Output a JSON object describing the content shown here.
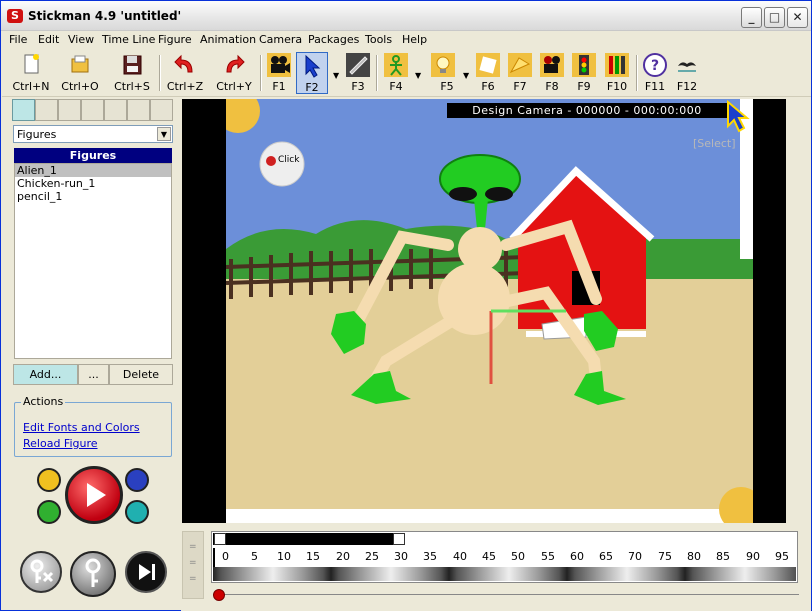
{
  "window": {
    "title": "Stickman 4.9  'untitled'",
    "logo_letter": "S"
  },
  "menu": [
    "File",
    "Edit",
    "View",
    "Time Line",
    "Figure",
    "Animation",
    "Camera",
    "Packages",
    "Tools",
    "Help"
  ],
  "toolbar": {
    "new_label": "Ctrl+N",
    "open_label": "Ctrl+O",
    "save_label": "Ctrl+S",
    "undo_label": "Ctrl+Z",
    "redo_label": "Ctrl+Y",
    "f1": "F1",
    "f2": "F2",
    "f3": "F3",
    "f4": "F4",
    "f5": "F5",
    "f6": "F6",
    "f7": "F7",
    "f8": "F8",
    "f9": "F9",
    "f10": "F10",
    "f11": "F11",
    "f12": "F12",
    "help_glyph": "?"
  },
  "left_panel": {
    "dropdown_value": "Figures",
    "list_header": "Figures",
    "items": [
      "Alien_1",
      "Chicken-run_1",
      "pencil_1"
    ],
    "selected_index": 0,
    "add_label": "Add...",
    "more_label": "...",
    "delete_label": "Delete",
    "actions_title": "Actions",
    "link_edit_fonts": "Edit Fonts and Colors",
    "link_reload": "Reload Figure"
  },
  "stage": {
    "camera_label": "Design Camera - 000000 - 000:00:000",
    "select_hint": "[Select]",
    "click_bubble": "Click"
  },
  "timeline": {
    "ticks": [
      "0",
      "5",
      "10",
      "15",
      "20",
      "25",
      "30",
      "35",
      "40",
      "45",
      "50",
      "55",
      "60",
      "65",
      "70",
      "75",
      "80",
      "85",
      "90",
      "95"
    ],
    "grip_glyph": "="
  },
  "colors": {
    "title_blue": "#000080",
    "sky": "#6c8fd9",
    "grass": "#3a9b36",
    "ground": "#e3cf98",
    "barn_red": "#e41212",
    "alien_green": "#22cc22",
    "alien_skin": "#f5dcb0"
  }
}
